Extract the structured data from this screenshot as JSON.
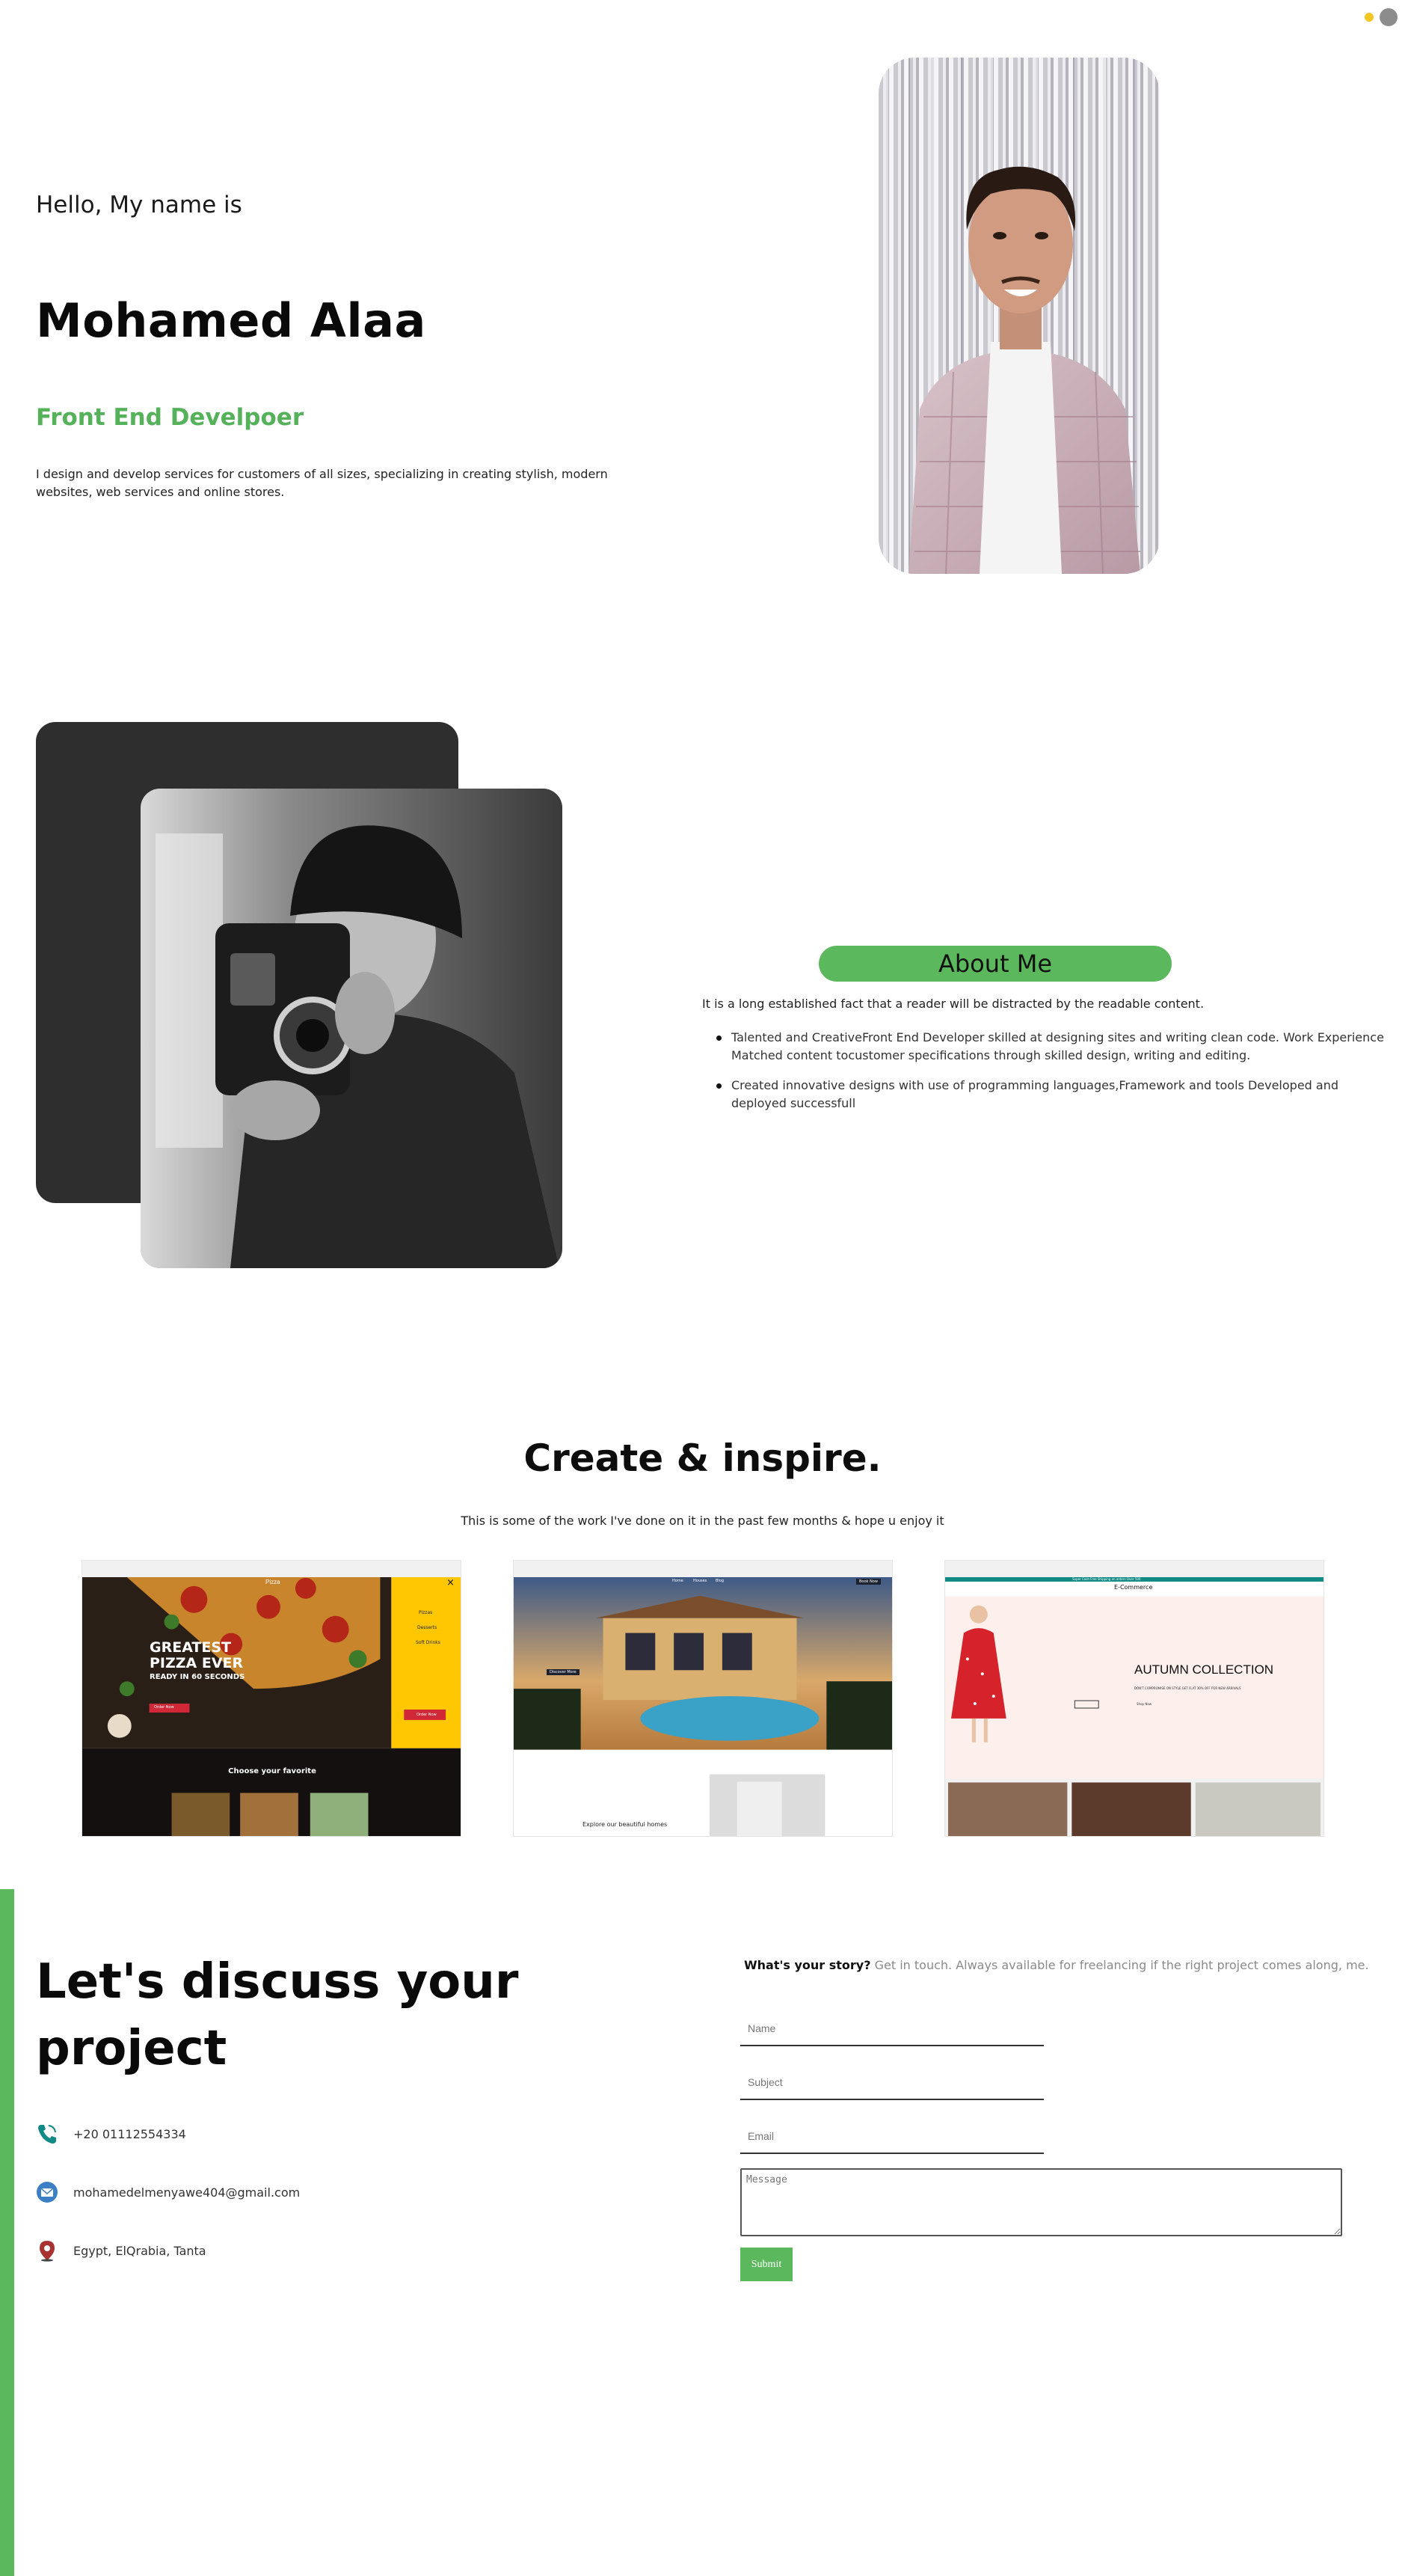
{
  "hero": {
    "greeting": "Hello, My name is",
    "name": "Mohamed Alaa",
    "role": "Front End Develpoer",
    "description": "I design and develop services for customers of all sizes, specializing in creating stylish, modern websites, web services and online stores."
  },
  "about": {
    "title": "About Me",
    "lead": "It is a long established fact that a reader will be distracted by the readable content.",
    "points": [
      "Talented and CreativeFront End Developer skilled at designing sites and writing clean code. Work Experience Matched content tocustomer specifications through skilled design, writing and editing.",
      "Created innovative designs with use of programming languages,Framework and tools Developed and deployed successfull"
    ]
  },
  "work": {
    "title": "Create & inspire.",
    "subtitle": "This is some of the work I've done on it in the past few months & hope u enjoy it",
    "cards": [
      {
        "logo": "Pizza",
        "headline1": "GREATEST",
        "headline2": "PIZZA EVER",
        "tagline": "READY IN 60 SECONDS",
        "cta": "Order Now",
        "menu": [
          "Pizzas",
          "Desserts",
          "Soft Drinks"
        ],
        "menu_cta": "Order Now",
        "close": "×",
        "section": "Choose your favorite"
      },
      {
        "nav": [
          "Home",
          "Houses",
          "Blog"
        ],
        "cta": "Book Now",
        "hero_btn": "Discover More",
        "section": "Explore our beautiful homes"
      },
      {
        "banner": "Super Cash Free Shipping on orders Over 500",
        "brand": "E-Commerce",
        "heading": "AUTUMN COLLECTION",
        "sub": "DON'T COMPROMISE ON STYLE GET FLAT 30% OFF FOR NEW ARRIVALS",
        "btn": "Shop Now"
      }
    ]
  },
  "contact": {
    "title": "Let's discuss your project",
    "phone": "+20 01112554334",
    "email": "mohamedelmenyawe404@gmail.com",
    "location": "Egypt, ElQrabia, Tanta",
    "story_bold": "What's your story?",
    "story_text": " Get in touch. Always available for freelancing if the right project comes along, me.",
    "name_placeholder": "Name",
    "subject_placeholder": "Subject",
    "email_placeholder": "Email",
    "message_placeholder": "Message",
    "submit": "Submit"
  },
  "icons": {
    "phone": "phone-icon",
    "mail": "mail-icon",
    "location": "location-pin-icon"
  },
  "colors": {
    "accent": "#5cb85c",
    "dark_card": "#2e2e2e"
  }
}
